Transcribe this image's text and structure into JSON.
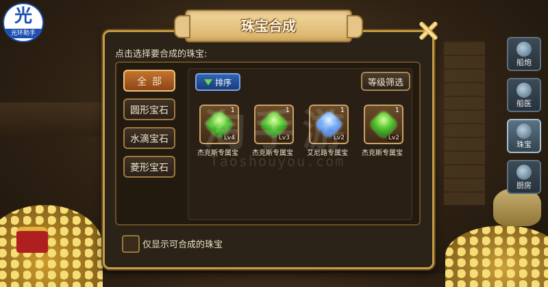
{
  "app_badge": {
    "glyph": "光",
    "label": "光环助手"
  },
  "dialog": {
    "title": "珠宝合成",
    "instruction": "点击选择要合成的珠宝:",
    "categories": [
      "全部",
      "圆形宝石",
      "水滴宝石",
      "菱形宝石"
    ],
    "active_category": "全部",
    "sort_label": "排序",
    "filter_label": "等级筛选",
    "gems": [
      {
        "count": "1",
        "level": "Lv4",
        "name": "杰克斯专属宝",
        "color": "green"
      },
      {
        "count": "1",
        "level": "Lv3",
        "name": "杰克斯专属宝",
        "color": "green"
      },
      {
        "count": "1",
        "level": "Lv2",
        "name": "艾尼路专属宝",
        "color": "blue"
      },
      {
        "count": "1",
        "level": "Lv2",
        "name": "杰克斯专属宝",
        "color": "green"
      }
    ],
    "checkbox_label": "仅显示可合成的珠宝"
  },
  "side_tabs": [
    {
      "label": "船炮",
      "icon": "cannon-icon",
      "active": false
    },
    {
      "label": "船医",
      "icon": "doctor-icon",
      "active": false
    },
    {
      "label": "珠宝",
      "icon": "jewel-icon",
      "active": true
    },
    {
      "label": "厨房",
      "icon": "kitchen-icon",
      "active": false
    }
  ],
  "watermark": {
    "main": "淘手游",
    "url": "Taoshouyou.com"
  },
  "colors": {
    "accent_gold": "#c69b43",
    "active_tab": "#c3742e",
    "sort_blue": "#2d64b7"
  }
}
